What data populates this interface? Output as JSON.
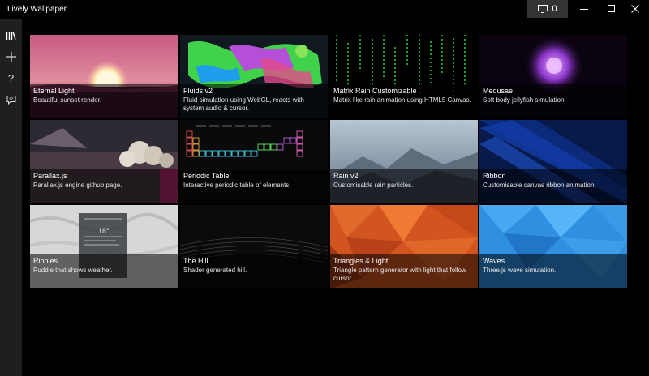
{
  "window": {
    "title": "Lively Wallpaper",
    "display_button": {
      "icon": "monitor-icon",
      "count": "0"
    }
  },
  "nav": [
    {
      "icon": "library-icon"
    },
    {
      "icon": "add-icon"
    },
    {
      "icon": "help-icon"
    },
    {
      "icon": "feedback-icon"
    }
  ],
  "wallpapers": [
    {
      "title": "Eternal Light",
      "description": "Beautiful sunset render."
    },
    {
      "title": "Fluids v2",
      "description": "Fluid simulation using WebGL, reacts with system audio & cursor."
    },
    {
      "title": "Matrix Rain Customizable",
      "description": "Matrix like rain animation using HTML5 Canvas."
    },
    {
      "title": "Medusae",
      "description": "Soft body jellyfish simulation."
    },
    {
      "title": "Parallax.js",
      "description": "Parallax.js engine github page."
    },
    {
      "title": "Periodic Table",
      "description": "Interactive periodic table of elements."
    },
    {
      "title": "Rain v2",
      "description": "Customisable rain particles."
    },
    {
      "title": "Ribbon",
      "description": "Customisable canvas ribbon animation."
    },
    {
      "title": "Ripples",
      "description": "Puddle that shows weather."
    },
    {
      "title": "The Hill",
      "description": "Shader generated hill."
    },
    {
      "title": "Triangles & Light",
      "description": "Triangle pattern generator with light that follow cursor."
    },
    {
      "title": "Waves",
      "description": "Three.js wave simulation."
    }
  ],
  "widget": {
    "temperature": "18°"
  }
}
